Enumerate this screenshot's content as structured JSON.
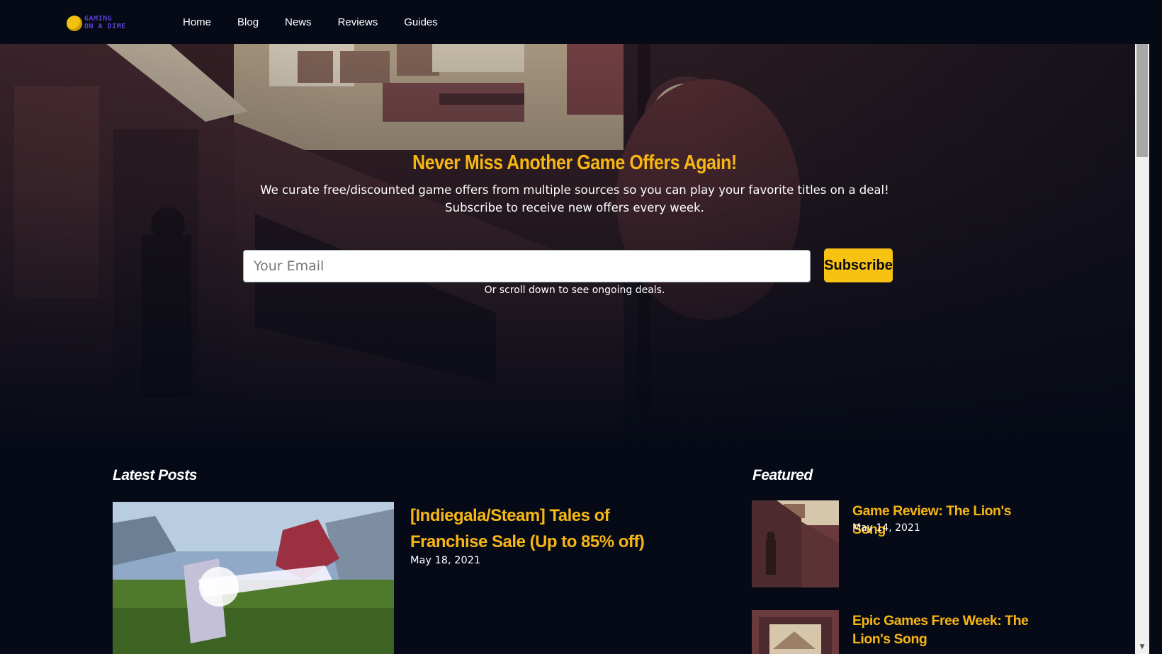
{
  "brand": {
    "logo_line1": "GAMING",
    "logo_line2": "ON A DIME"
  },
  "nav": {
    "items": [
      {
        "label": "Home"
      },
      {
        "label": "Blog"
      },
      {
        "label": "News"
      },
      {
        "label": "Reviews"
      },
      {
        "label": "Guides"
      }
    ]
  },
  "hero": {
    "title": "Never Miss Another Game Offers Again!",
    "subtitle_line1": "We curate free/discounted game offers from multiple sources so you can play your favorite titles on a deal!",
    "subtitle_line2": "Subscribe to receive new offers every week.",
    "email_placeholder": "Your Email",
    "email_value": "",
    "subscribe_label": "Subscribe",
    "scroll_note": "Or scroll down to see ongoing deals."
  },
  "latest": {
    "heading": "Latest Posts",
    "posts": [
      {
        "title": "[Indiegala/Steam] Tales of Franchise Sale (Up to 85% off)",
        "date": "May 18, 2021"
      }
    ]
  },
  "featured": {
    "heading": "Featured",
    "items": [
      {
        "title": "Game Review: The Lion's Song",
        "date": "May 14, 2021"
      },
      {
        "title": "Epic Games Free Week: The Lion's Song"
      }
    ]
  },
  "colors": {
    "accent": "#f7b614",
    "background": "#050a16",
    "button": "#f7c211"
  }
}
